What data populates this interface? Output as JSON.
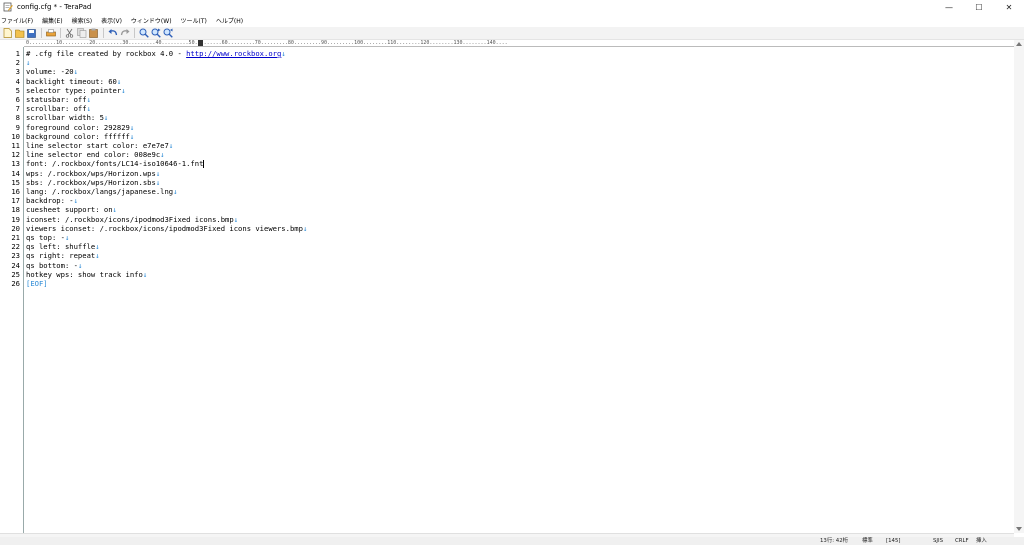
{
  "window": {
    "title": "config.cfg * - TeraPad",
    "minimize": "—",
    "maximize": "☐",
    "close": "✕"
  },
  "menu": [
    "ファイル(F)",
    "編集(E)",
    "検索(S)",
    "表示(V)",
    "ウィンドウ(W)",
    "ツール(T)",
    "ヘルプ(H)"
  ],
  "toolbar": {
    "icons": [
      "new-file-icon",
      "open-file-icon",
      "save-icon",
      "print-icon",
      "cut-icon",
      "copy-icon",
      "paste-icon",
      "undo-icon",
      "redo-icon",
      "find-icon",
      "find-next-icon",
      "find-prev-icon"
    ]
  },
  "ruler": {
    "text": "0.........10.........20.........30.........40.........50.........60.........70.........80.........90.........100........110........120........130........140...."
  },
  "editor": {
    "lines": [
      {
        "num": "1",
        "text": "# .cfg file created by rockbox 4.0 - ",
        "link": "http://www.rockbox.org",
        "eol": "↓"
      },
      {
        "num": "2",
        "text": "",
        "eol": "↓"
      },
      {
        "num": "3",
        "text": "volume: -20",
        "eol": "↓"
      },
      {
        "num": "4",
        "text": "backlight timeout: 60",
        "eol": "↓"
      },
      {
        "num": "5",
        "text": "selector type: pointer",
        "eol": "↓"
      },
      {
        "num": "6",
        "text": "statusbar: off",
        "eol": "↓"
      },
      {
        "num": "7",
        "text": "scrollbar: off",
        "eol": "↓"
      },
      {
        "num": "8",
        "text": "scrollbar width: 5",
        "eol": "↓"
      },
      {
        "num": "9",
        "text": "foreground color: 292829",
        "eol": "↓"
      },
      {
        "num": "10",
        "text": "background color: ffffff",
        "eol": "↓"
      },
      {
        "num": "11",
        "text": "line selector start color: e7e7e7",
        "eol": "↓"
      },
      {
        "num": "12",
        "text": "line selector end color: 008e9c",
        "eol": "↓"
      },
      {
        "num": "13",
        "text": "font: /.rockbox/fonts/LC14-iso10646-1.fnt",
        "eol": ""
      },
      {
        "num": "14",
        "text": "wps: /.rockbox/wps/Horizon.wps",
        "eol": "↓"
      },
      {
        "num": "15",
        "text": "sbs: /.rockbox/wps/Horizon.sbs",
        "eol": "↓"
      },
      {
        "num": "16",
        "text": "lang: /.rockbox/langs/japanese.lng",
        "eol": "↓"
      },
      {
        "num": "17",
        "text": "backdrop: -",
        "eol": "↓"
      },
      {
        "num": "18",
        "text": "cuesheet support: on",
        "eol": "↓"
      },
      {
        "num": "19",
        "text": "iconset: /.rockbox/icons/ipodmod3Fixed icons.bmp",
        "eol": "↓"
      },
      {
        "num": "20",
        "text": "viewers iconset: /.rockbox/icons/ipodmod3Fixed icons viewers.bmp",
        "eol": "↓"
      },
      {
        "num": "21",
        "text": "qs top: -",
        "eol": "↓"
      },
      {
        "num": "22",
        "text": "qs left: shuffle",
        "eol": "↓"
      },
      {
        "num": "23",
        "text": "qs right: repeat",
        "eol": "↓"
      },
      {
        "num": "24",
        "text": "qs bottom: -",
        "eol": "↓"
      },
      {
        "num": "25",
        "text": "hotkey wps: show track info",
        "eol": "↓"
      },
      {
        "num": "26",
        "text": "[EOF]",
        "eol": "",
        "is_eof": true
      }
    ]
  },
  "status": {
    "position": "13行: 42桁",
    "mode": "標準",
    "code": "[145]",
    "encoding": "SJIS",
    "line_ending": "CRLF",
    "insert": "挿入"
  },
  "colors": {
    "eol_marker": "#2a8ad6",
    "link": "#0000cc"
  }
}
